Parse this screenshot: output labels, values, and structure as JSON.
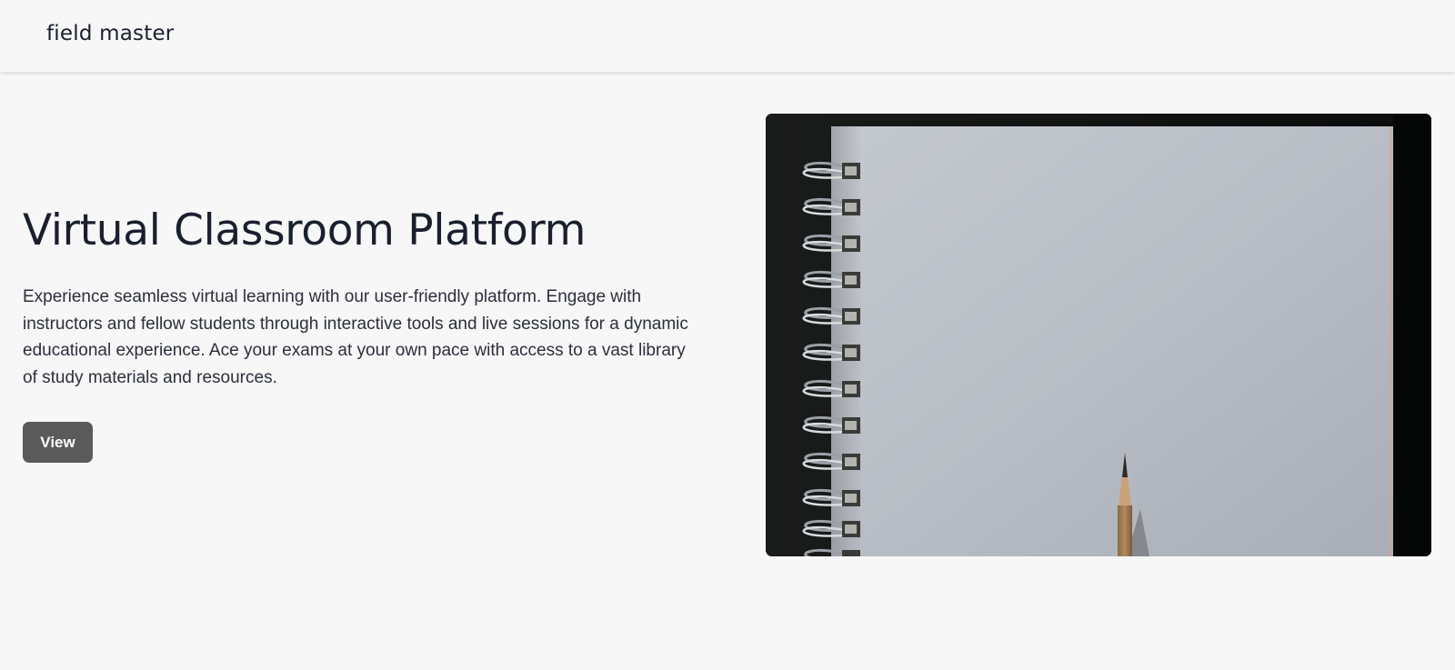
{
  "header": {
    "brand": "field master"
  },
  "hero": {
    "title": "Virtual Classroom Platform",
    "description": "Experience seamless virtual learning with our user-friendly platform. Engage with instructors and fellow students through interactive tools and live sessions for a dynamic educational experience. Ace your exams at your own pace with access to a vast library of study materials and resources.",
    "button_label": "View",
    "image_subject": "spiral notebook with pencil"
  },
  "colors": {
    "background": "#f7f7f7",
    "text": "#1a1f2e",
    "button": "#5a5a5a",
    "button_text": "#ffffff"
  }
}
